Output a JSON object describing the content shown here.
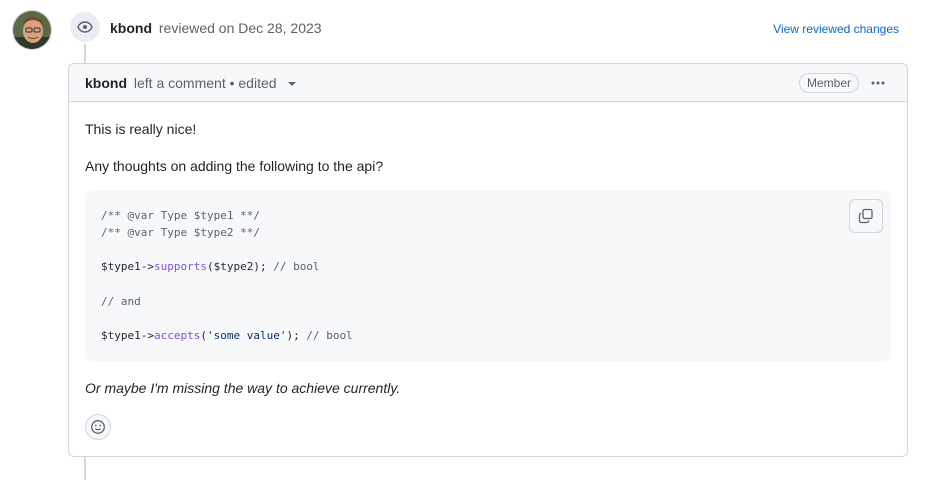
{
  "event": {
    "author": "kbond",
    "action_text": "reviewed on Dec 28, 2023",
    "view_changes_link": "View reviewed changes",
    "badge_icon": "eye-icon"
  },
  "comment": {
    "author": "kbond",
    "action_text": "left a comment • edited",
    "role_badge": "Member",
    "paragraph_1": "This is really nice!",
    "paragraph_2": "Any thoughts on adding the following to the api?",
    "paragraph_3": "Or maybe I'm missing the way to achieve currently.",
    "code": {
      "line_1": "/** @var Type $type1 **/",
      "line_2": "/** @var Type $type2 **/",
      "line_3_var": "$type1->",
      "line_3_fn": "supports",
      "line_3_args": "($type2);",
      "line_3_comment": " // bool",
      "line_4": "// and",
      "line_5_var": "$type1->",
      "line_5_fn": "accepts",
      "line_5_open": "(",
      "line_5_str": "'some value'",
      "line_5_close": ");",
      "line_5_comment": " // bool"
    }
  },
  "colors": {
    "link": "#0969da",
    "border": "#d0d7de",
    "header_bg": "#f6f8fa",
    "function": "#8250df",
    "string": "#0a3069"
  }
}
